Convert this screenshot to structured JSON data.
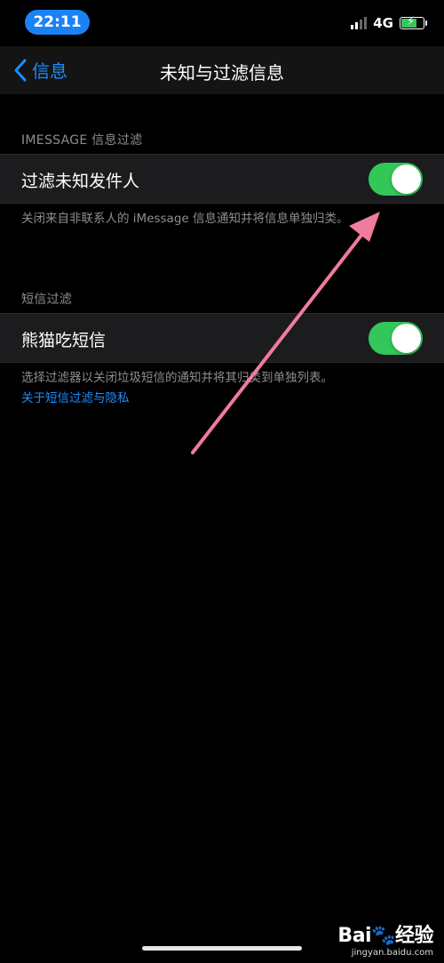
{
  "status_bar": {
    "time": "22:11",
    "network": "4G",
    "battery_level": 0.65
  },
  "nav": {
    "back_label": "信息",
    "title": "未知与过滤信息"
  },
  "imessage_section": {
    "header": "IMESSAGE 信息过滤",
    "toggle_label": "过滤未知发件人",
    "toggle_on": true,
    "footer": "关闭来自非联系人的 iMessage 信息通知并将信息单独归类。"
  },
  "sms_section": {
    "header": "短信过滤",
    "toggle_label": "熊猫吃短信",
    "toggle_on": true,
    "footer": "选择过滤器以关闭垃圾短信的通知并将其归类到单独列表。",
    "link": "关于短信过滤与隐私"
  },
  "watermark": {
    "brand_a": "Bai",
    "brand_b": "经验",
    "url": "jingyan.baidu.com"
  },
  "colors": {
    "accent": "#1e8cff",
    "toggle_on": "#33c759",
    "arrow": "#f07c9c"
  }
}
